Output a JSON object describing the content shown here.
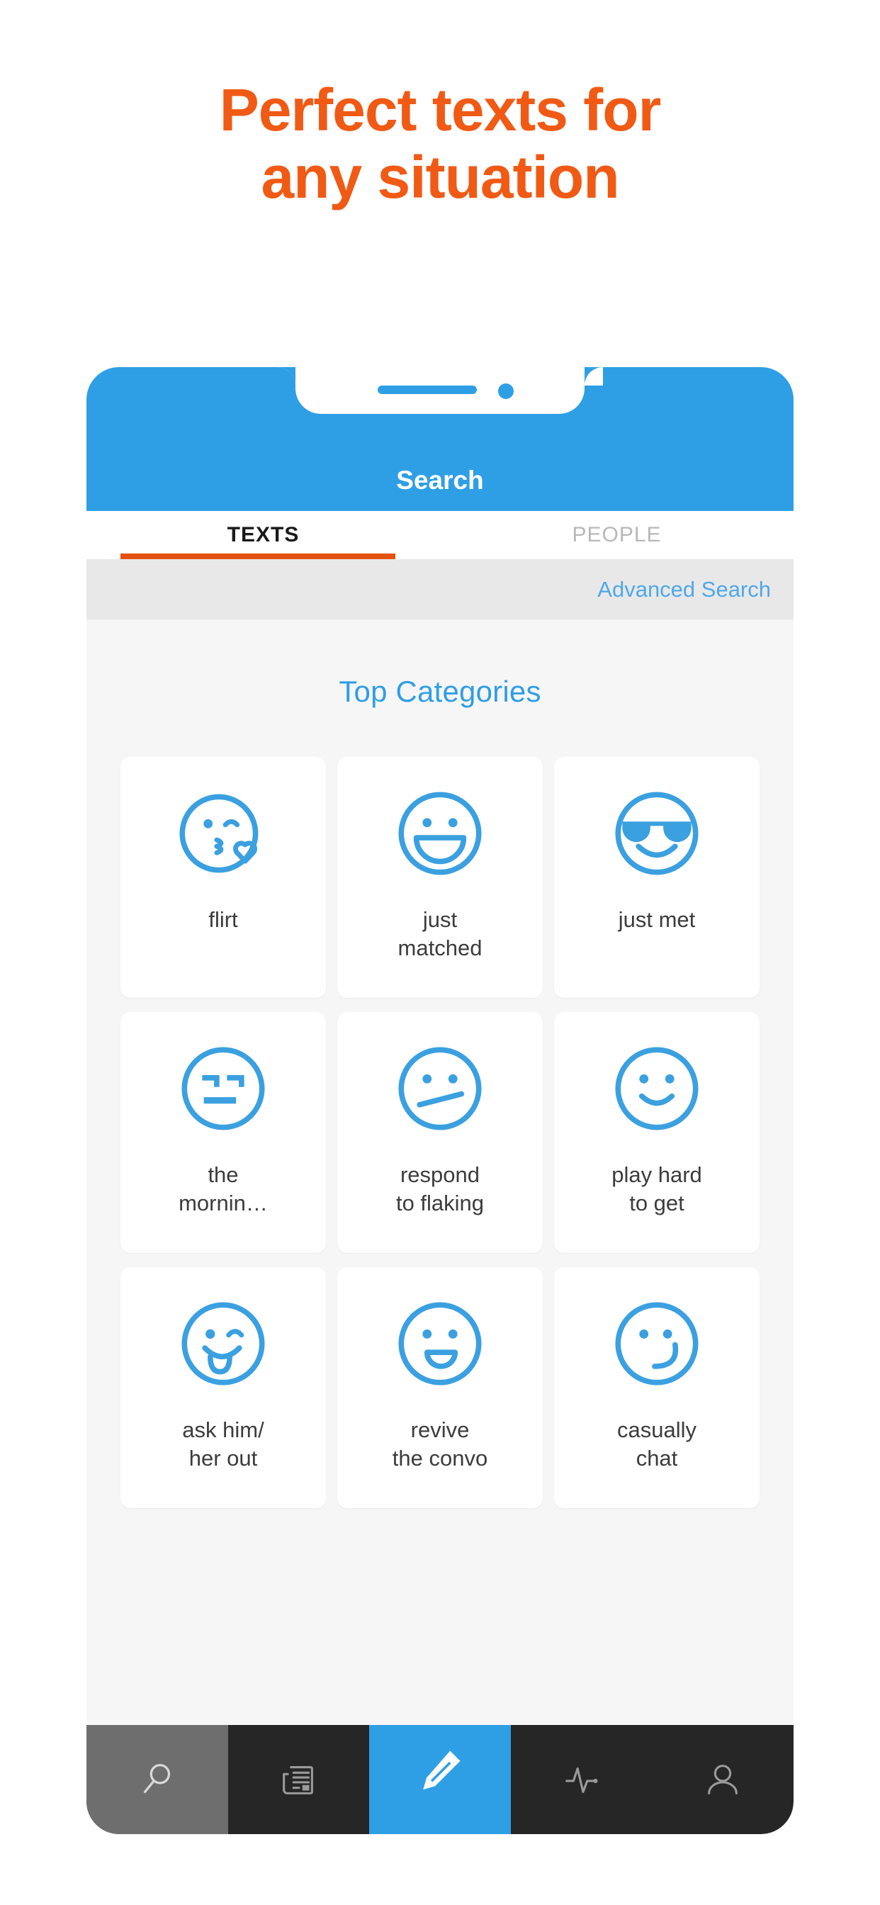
{
  "promo": {
    "headline_line1": "Perfect texts for",
    "headline_line2": "any situation",
    "headline_color": "#F05A14"
  },
  "phone": {
    "header": {
      "title": "Search",
      "background_color": "#2F9FE5",
      "notch_speaker_icon": "speaker-grill-icon",
      "notch_camera_icon": "front-camera-icon"
    },
    "segment_tabs": [
      {
        "label": "TEXTS",
        "active": true
      },
      {
        "label": "PEOPLE",
        "active": false
      }
    ],
    "segment_underline_color": "#E2510E",
    "advanced_search": {
      "label": "Advanced Search",
      "color": "#4FA8E8"
    },
    "section": {
      "title": "Top Categories",
      "title_color": "#2F9FE5"
    },
    "categories": [
      {
        "label": "flirt",
        "icon": "kissing-wink-heart-face-icon"
      },
      {
        "label": "just\nmatched",
        "icon": "grinning-open-smile-face-icon"
      },
      {
        "label": "just met",
        "icon": "sunglasses-cool-face-icon"
      },
      {
        "label": "the\nmornin…",
        "icon": "expressionless-flat-face-icon"
      },
      {
        "label": "respond\nto flaking",
        "icon": "skeptical-slanted-mouth-face-icon"
      },
      {
        "label": "play hard\nto get",
        "icon": "slight-smile-face-icon"
      },
      {
        "label": "ask him/\nher out",
        "icon": "winking-tongue-out-face-icon"
      },
      {
        "label": "revive\nthe convo",
        "icon": "open-mouth-smile-face-icon"
      },
      {
        "label": "casually\nchat",
        "icon": "smirking-face-icon"
      }
    ],
    "bottom_nav": [
      {
        "name": "search",
        "icon": "magnifier-icon",
        "state": "highlighted"
      },
      {
        "name": "feed",
        "icon": "newspaper-icon",
        "state": "normal"
      },
      {
        "name": "compose",
        "icon": "pencil-icon",
        "state": "active"
      },
      {
        "name": "activity",
        "icon": "pulse-icon",
        "state": "normal"
      },
      {
        "name": "profile",
        "icon": "person-icon",
        "state": "normal"
      }
    ],
    "bottom_nav_active_color": "#2F9FE5",
    "bottom_nav_background": "#262626"
  }
}
